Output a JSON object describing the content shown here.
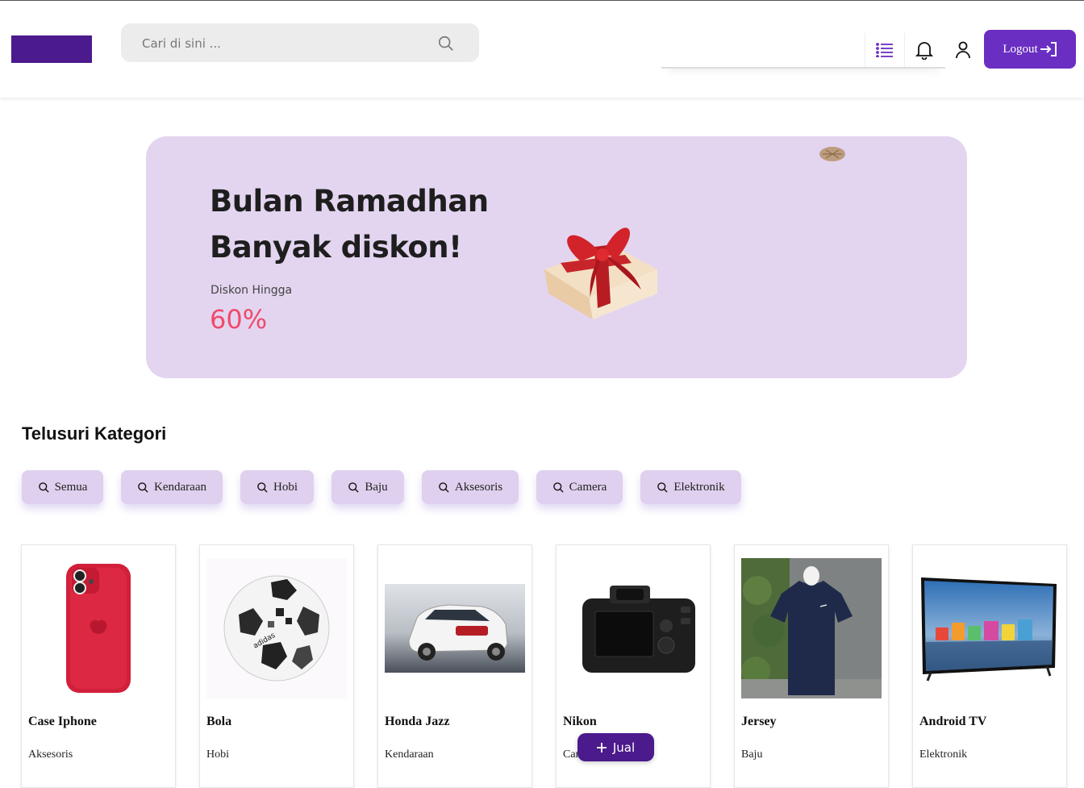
{
  "header": {
    "search_placeholder": "Cari di sini ...",
    "search_icon": "search-icon",
    "menu_icon": "list-icon",
    "notification_icon": "bell-icon",
    "profile_icon": "user-icon",
    "logout_label": "Logout",
    "logout_icon": "sign-in-arrow-icon",
    "brand_color": "#4b1a8c",
    "accent_color": "#6a2ec2"
  },
  "banner": {
    "title_line1": "Bulan Ramadhan",
    "title_line2": "Banyak diskon!",
    "subtitle": "Diskon Hingga",
    "discount": "60%",
    "background": "#e3d5f0",
    "discount_color": "#f04a6a"
  },
  "categories": {
    "title": "Telusuri Kategori",
    "items": [
      {
        "label": "Semua"
      },
      {
        "label": "Kendaraan"
      },
      {
        "label": "Hobi"
      },
      {
        "label": "Baju"
      },
      {
        "label": "Aksesoris"
      },
      {
        "label": "Camera"
      },
      {
        "label": "Elektronik"
      }
    ]
  },
  "products": [
    {
      "name": "Case Iphone",
      "category": "Aksesoris"
    },
    {
      "name": "Bola",
      "category": "Hobi"
    },
    {
      "name": "Honda Jazz",
      "category": "Kendaraan"
    },
    {
      "name": "Nikon",
      "category": "Camera"
    },
    {
      "name": "Jersey",
      "category": "Baju"
    },
    {
      "name": "Android TV",
      "category": "Elektronik"
    }
  ],
  "fab": {
    "label": "Jual",
    "icon": "plus-icon"
  }
}
